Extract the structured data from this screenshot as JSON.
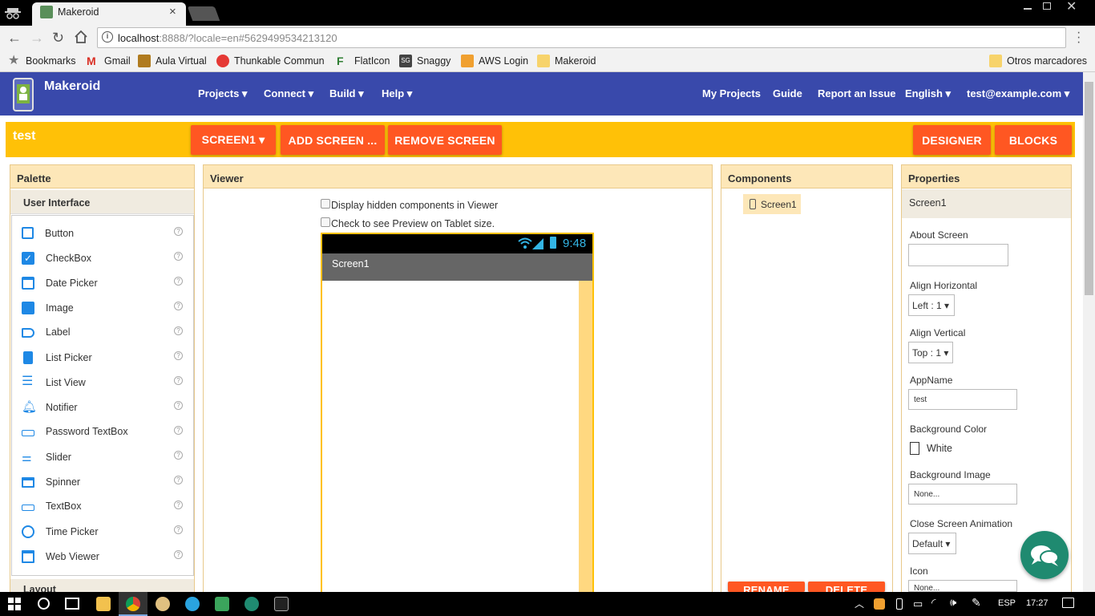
{
  "browser": {
    "tab_title": "Makeroid",
    "url_host": "localhost",
    "url_rest": ":8888/?locale=en#5629499534213120",
    "bookmarks": [
      {
        "label": "Bookmarks",
        "icon": "star-icon",
        "color": "#777777"
      },
      {
        "label": "Gmail",
        "icon": "gmail-icon",
        "color": "#d93025"
      },
      {
        "label": "Aula Virtual",
        "icon": "building-icon",
        "color": "#b07b1f"
      },
      {
        "label": "Thunkable Communi",
        "icon": "thunkable-icon",
        "color": "#e53935"
      },
      {
        "label": "FlatIcon",
        "icon": "flaticon-icon",
        "color": "#2e7d32"
      },
      {
        "label": "Snaggy",
        "icon": "snaggy-icon",
        "color": "#444444"
      },
      {
        "label": "AWS Login",
        "icon": "aws-icon",
        "color": "#f0a030"
      },
      {
        "label": "Makeroid",
        "icon": "folder-icon",
        "color": "#f7d36b"
      }
    ],
    "other_bookmarks": "Otros marcadores"
  },
  "app": {
    "name": "Makeroid",
    "menus": [
      "Projects ▾",
      "Connect ▾",
      "Build ▾",
      "Help ▾"
    ],
    "right_links": [
      "My Projects",
      "Guide",
      "Report an Issue",
      "English ▾",
      "test@example.com ▾"
    ],
    "accent": "#3949ab",
    "yellow": "#ffc107",
    "orange": "#ff5722"
  },
  "project": {
    "name": "test",
    "screen_button": "SCREEN1 ▾",
    "add_screen": "ADD SCREEN ...",
    "remove_screen": "REMOVE SCREEN",
    "designer": "DESIGNER",
    "blocks": "BLOCKS"
  },
  "palette": {
    "title": "Palette",
    "section": "User Interface",
    "items": [
      {
        "label": "Button",
        "icon": "button-icon"
      },
      {
        "label": "CheckBox",
        "icon": "checkbox-icon"
      },
      {
        "label": "Date Picker",
        "icon": "calendar-icon"
      },
      {
        "label": "Image",
        "icon": "image-icon"
      },
      {
        "label": "Label",
        "icon": "label-icon"
      },
      {
        "label": "List Picker",
        "icon": "list-picker-icon"
      },
      {
        "label": "List View",
        "icon": "list-view-icon"
      },
      {
        "label": "Notifier",
        "icon": "bell-icon"
      },
      {
        "label": "Password TextBox",
        "icon": "password-icon"
      },
      {
        "label": "Slider",
        "icon": "slider-icon"
      },
      {
        "label": "Spinner",
        "icon": "spinner-icon"
      },
      {
        "label": "TextBox",
        "icon": "textbox-icon"
      },
      {
        "label": "Time Picker",
        "icon": "clock-icon"
      },
      {
        "label": "Web Viewer",
        "icon": "webviewer-icon"
      }
    ],
    "help_glyph": "?",
    "next_section": "Layout"
  },
  "viewer": {
    "title": "Viewer",
    "hidden_components": "Display hidden components in Viewer",
    "tablet_preview": "Check to see Preview on Tablet size.",
    "time": "9:48",
    "screen_title": "Screen1"
  },
  "components": {
    "title": "Components",
    "root": "Screen1",
    "rename": "RENAME",
    "delete": "DELETE"
  },
  "properties": {
    "title": "Properties",
    "selected": "Screen1",
    "about_screen": "About Screen",
    "align_horizontal": "Align Horizontal",
    "align_horizontal_value": "Left : 1 ▾",
    "align_vertical": "Align Vertical",
    "align_vertical_value": "Top : 1 ▾",
    "app_name": "AppName",
    "app_name_value": "test",
    "background_color": "Background Color",
    "background_color_value": "White",
    "background_image": "Background Image",
    "background_image_value": "None...",
    "close_animation": "Close Screen Animation",
    "close_animation_value": "Default ▾",
    "icon": "Icon",
    "icon_value": "None..."
  },
  "taskbar": {
    "language": "ESP",
    "time": "17:27"
  }
}
